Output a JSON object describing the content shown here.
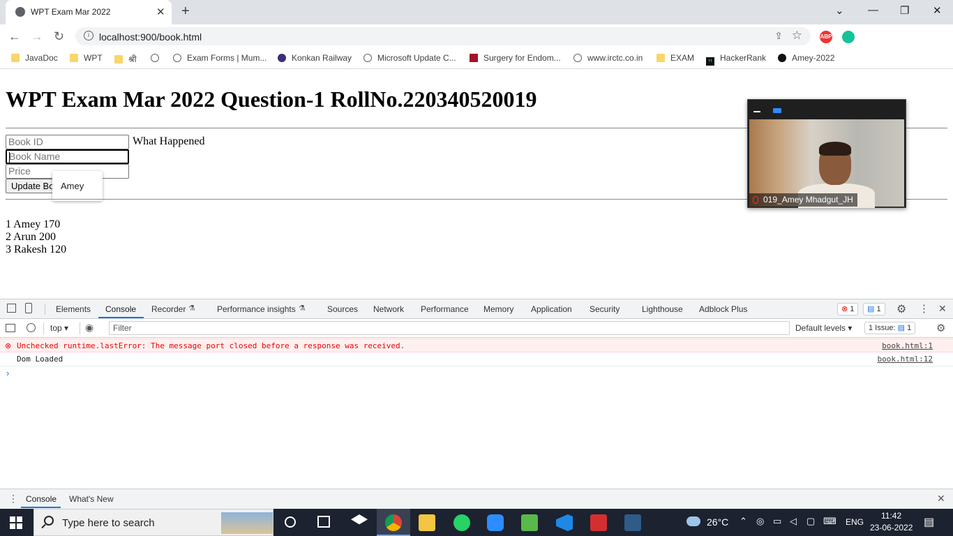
{
  "browser": {
    "tab_title": "WPT Exam Mar 2022",
    "url": "localhost:900/book.html",
    "bookmarks": [
      "JavaDoc",
      "WPT",
      "श्री",
      "Exam Forms | Mum...",
      "Konkan Railway",
      "Microsoft Update C...",
      "Surgery for Endom...",
      "www.irctc.co.in",
      "EXAM",
      "HackerRank",
      "Amey-2022"
    ],
    "extensions": {
      "abp": "ABP"
    }
  },
  "page": {
    "heading": "WPT Exam Mar 2022 Question-1 RollNo.220340520019",
    "book_id_placeholder": "Book ID",
    "status_text": "What Happened",
    "book_name_placeholder": "Book Name",
    "price_placeholder": "Price",
    "update_button": "Update Book",
    "autofill_suggestion": "Amey",
    "books": [
      {
        "text": "1 Amey 170"
      },
      {
        "text": "2 Arun 200"
      },
      {
        "text": "3 Rakesh 120"
      }
    ]
  },
  "video": {
    "participant": "019_Amey Mhadgut_JH"
  },
  "devtools": {
    "tabs": [
      "Elements",
      "Console",
      "Recorder",
      "Performance insights",
      "Sources",
      "Network",
      "Performance",
      "Memory",
      "Application",
      "Security",
      "Lighthouse",
      "Adblock Plus"
    ],
    "error_count": "1",
    "message_count": "1",
    "context": "top",
    "filter_placeholder": "Filter",
    "levels": "Default levels",
    "issues_label": "1 Issue:",
    "issues_count": "1",
    "messages": [
      {
        "level": "error",
        "text": "Unchecked runtime.lastError: The message port closed before a response was received.",
        "source": "book.html:1"
      },
      {
        "level": "log",
        "text": "Dom Loaded",
        "source": "book.html:12"
      }
    ],
    "drawer_tabs": [
      "Console",
      "What's New"
    ]
  },
  "taskbar": {
    "search_placeholder": "Type here to search",
    "weather": "26°C",
    "language": "ENG",
    "time": "11:42",
    "date": "23-06-2022"
  },
  "colors": {
    "accent": "#1a73e8",
    "error": "#e00000",
    "taskbar": "#1c2230"
  }
}
